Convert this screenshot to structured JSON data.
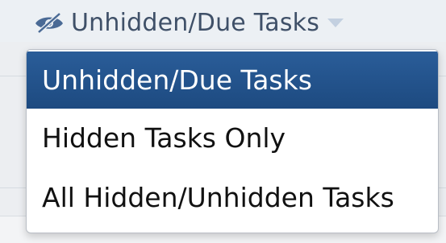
{
  "filter": {
    "current_label": "Unhidden/Due Tasks",
    "icon": "eye-hidden-icon",
    "caret_icon": "chevron-down-icon"
  },
  "menu": {
    "items": [
      {
        "label": "Unhidden/Due Tasks",
        "selected": true
      },
      {
        "label": "Hidden Tasks Only",
        "selected": false
      },
      {
        "label": "All Hidden/Unhidden Tasks",
        "selected": false
      }
    ]
  },
  "colors": {
    "selected_bg": "#1d4a80",
    "trigger_text": "#3f5068",
    "icon": "#4a6a95"
  }
}
